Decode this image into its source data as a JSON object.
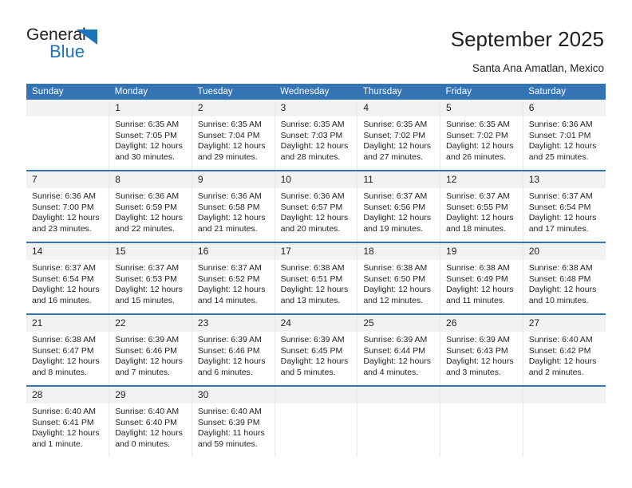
{
  "brand": {
    "name_top": "General",
    "name_bottom": "Blue",
    "accent_color": "#1b75bb"
  },
  "header": {
    "title": "September 2025",
    "subtitle": "Santa Ana Amatlan, Mexico"
  },
  "calendar": {
    "header_bg": "#3474b4",
    "daynum_bg": "#f2f2f2",
    "weekdays": [
      "Sunday",
      "Monday",
      "Tuesday",
      "Wednesday",
      "Thursday",
      "Friday",
      "Saturday"
    ],
    "weeks": [
      [
        {
          "day": "",
          "sunrise": "",
          "sunset": "",
          "daylight_1": "",
          "daylight_2": ""
        },
        {
          "day": "1",
          "sunrise": "Sunrise: 6:35 AM",
          "sunset": "Sunset: 7:05 PM",
          "daylight_1": "Daylight: 12 hours",
          "daylight_2": "and 30 minutes."
        },
        {
          "day": "2",
          "sunrise": "Sunrise: 6:35 AM",
          "sunset": "Sunset: 7:04 PM",
          "daylight_1": "Daylight: 12 hours",
          "daylight_2": "and 29 minutes."
        },
        {
          "day": "3",
          "sunrise": "Sunrise: 6:35 AM",
          "sunset": "Sunset: 7:03 PM",
          "daylight_1": "Daylight: 12 hours",
          "daylight_2": "and 28 minutes."
        },
        {
          "day": "4",
          "sunrise": "Sunrise: 6:35 AM",
          "sunset": "Sunset: 7:02 PM",
          "daylight_1": "Daylight: 12 hours",
          "daylight_2": "and 27 minutes."
        },
        {
          "day": "5",
          "sunrise": "Sunrise: 6:35 AM",
          "sunset": "Sunset: 7:02 PM",
          "daylight_1": "Daylight: 12 hours",
          "daylight_2": "and 26 minutes."
        },
        {
          "day": "6",
          "sunrise": "Sunrise: 6:36 AM",
          "sunset": "Sunset: 7:01 PM",
          "daylight_1": "Daylight: 12 hours",
          "daylight_2": "and 25 minutes."
        }
      ],
      [
        {
          "day": "7",
          "sunrise": "Sunrise: 6:36 AM",
          "sunset": "Sunset: 7:00 PM",
          "daylight_1": "Daylight: 12 hours",
          "daylight_2": "and 23 minutes."
        },
        {
          "day": "8",
          "sunrise": "Sunrise: 6:36 AM",
          "sunset": "Sunset: 6:59 PM",
          "daylight_1": "Daylight: 12 hours",
          "daylight_2": "and 22 minutes."
        },
        {
          "day": "9",
          "sunrise": "Sunrise: 6:36 AM",
          "sunset": "Sunset: 6:58 PM",
          "daylight_1": "Daylight: 12 hours",
          "daylight_2": "and 21 minutes."
        },
        {
          "day": "10",
          "sunrise": "Sunrise: 6:36 AM",
          "sunset": "Sunset: 6:57 PM",
          "daylight_1": "Daylight: 12 hours",
          "daylight_2": "and 20 minutes."
        },
        {
          "day": "11",
          "sunrise": "Sunrise: 6:37 AM",
          "sunset": "Sunset: 6:56 PM",
          "daylight_1": "Daylight: 12 hours",
          "daylight_2": "and 19 minutes."
        },
        {
          "day": "12",
          "sunrise": "Sunrise: 6:37 AM",
          "sunset": "Sunset: 6:55 PM",
          "daylight_1": "Daylight: 12 hours",
          "daylight_2": "and 18 minutes."
        },
        {
          "day": "13",
          "sunrise": "Sunrise: 6:37 AM",
          "sunset": "Sunset: 6:54 PM",
          "daylight_1": "Daylight: 12 hours",
          "daylight_2": "and 17 minutes."
        }
      ],
      [
        {
          "day": "14",
          "sunrise": "Sunrise: 6:37 AM",
          "sunset": "Sunset: 6:54 PM",
          "daylight_1": "Daylight: 12 hours",
          "daylight_2": "and 16 minutes."
        },
        {
          "day": "15",
          "sunrise": "Sunrise: 6:37 AM",
          "sunset": "Sunset: 6:53 PM",
          "daylight_1": "Daylight: 12 hours",
          "daylight_2": "and 15 minutes."
        },
        {
          "day": "16",
          "sunrise": "Sunrise: 6:37 AM",
          "sunset": "Sunset: 6:52 PM",
          "daylight_1": "Daylight: 12 hours",
          "daylight_2": "and 14 minutes."
        },
        {
          "day": "17",
          "sunrise": "Sunrise: 6:38 AM",
          "sunset": "Sunset: 6:51 PM",
          "daylight_1": "Daylight: 12 hours",
          "daylight_2": "and 13 minutes."
        },
        {
          "day": "18",
          "sunrise": "Sunrise: 6:38 AM",
          "sunset": "Sunset: 6:50 PM",
          "daylight_1": "Daylight: 12 hours",
          "daylight_2": "and 12 minutes."
        },
        {
          "day": "19",
          "sunrise": "Sunrise: 6:38 AM",
          "sunset": "Sunset: 6:49 PM",
          "daylight_1": "Daylight: 12 hours",
          "daylight_2": "and 11 minutes."
        },
        {
          "day": "20",
          "sunrise": "Sunrise: 6:38 AM",
          "sunset": "Sunset: 6:48 PM",
          "daylight_1": "Daylight: 12 hours",
          "daylight_2": "and 10 minutes."
        }
      ],
      [
        {
          "day": "21",
          "sunrise": "Sunrise: 6:38 AM",
          "sunset": "Sunset: 6:47 PM",
          "daylight_1": "Daylight: 12 hours",
          "daylight_2": "and 8 minutes."
        },
        {
          "day": "22",
          "sunrise": "Sunrise: 6:39 AM",
          "sunset": "Sunset: 6:46 PM",
          "daylight_1": "Daylight: 12 hours",
          "daylight_2": "and 7 minutes."
        },
        {
          "day": "23",
          "sunrise": "Sunrise: 6:39 AM",
          "sunset": "Sunset: 6:46 PM",
          "daylight_1": "Daylight: 12 hours",
          "daylight_2": "and 6 minutes."
        },
        {
          "day": "24",
          "sunrise": "Sunrise: 6:39 AM",
          "sunset": "Sunset: 6:45 PM",
          "daylight_1": "Daylight: 12 hours",
          "daylight_2": "and 5 minutes."
        },
        {
          "day": "25",
          "sunrise": "Sunrise: 6:39 AM",
          "sunset": "Sunset: 6:44 PM",
          "daylight_1": "Daylight: 12 hours",
          "daylight_2": "and 4 minutes."
        },
        {
          "day": "26",
          "sunrise": "Sunrise: 6:39 AM",
          "sunset": "Sunset: 6:43 PM",
          "daylight_1": "Daylight: 12 hours",
          "daylight_2": "and 3 minutes."
        },
        {
          "day": "27",
          "sunrise": "Sunrise: 6:40 AM",
          "sunset": "Sunset: 6:42 PM",
          "daylight_1": "Daylight: 12 hours",
          "daylight_2": "and 2 minutes."
        }
      ],
      [
        {
          "day": "28",
          "sunrise": "Sunrise: 6:40 AM",
          "sunset": "Sunset: 6:41 PM",
          "daylight_1": "Daylight: 12 hours",
          "daylight_2": "and 1 minute."
        },
        {
          "day": "29",
          "sunrise": "Sunrise: 6:40 AM",
          "sunset": "Sunset: 6:40 PM",
          "daylight_1": "Daylight: 12 hours",
          "daylight_2": "and 0 minutes."
        },
        {
          "day": "30",
          "sunrise": "Sunrise: 6:40 AM",
          "sunset": "Sunset: 6:39 PM",
          "daylight_1": "Daylight: 11 hours",
          "daylight_2": "and 59 minutes."
        },
        {
          "day": "",
          "sunrise": "",
          "sunset": "",
          "daylight_1": "",
          "daylight_2": ""
        },
        {
          "day": "",
          "sunrise": "",
          "sunset": "",
          "daylight_1": "",
          "daylight_2": ""
        },
        {
          "day": "",
          "sunrise": "",
          "sunset": "",
          "daylight_1": "",
          "daylight_2": ""
        },
        {
          "day": "",
          "sunrise": "",
          "sunset": "",
          "daylight_1": "",
          "daylight_2": ""
        }
      ]
    ]
  }
}
